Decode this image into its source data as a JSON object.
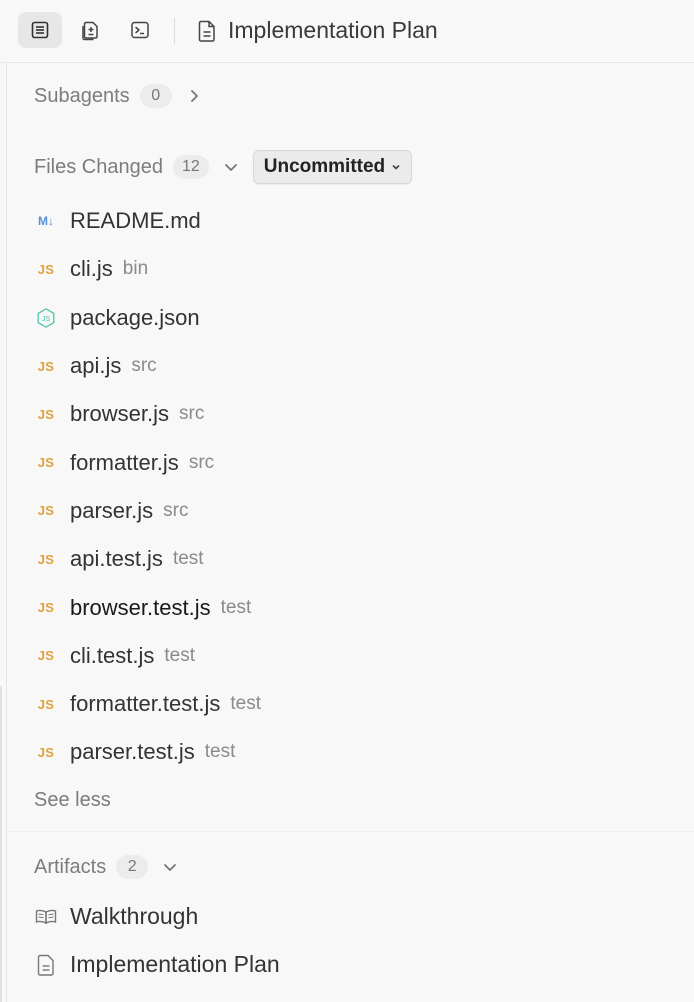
{
  "toolbar": {
    "title": "Implementation Plan",
    "buttons": [
      "document-icon",
      "files-diff-icon",
      "terminal-icon"
    ]
  },
  "subagents": {
    "label": "Subagents",
    "count": "0"
  },
  "files_changed": {
    "label": "Files Changed",
    "count": "12",
    "filter_label": "Uncommitted",
    "files": [
      {
        "name": "README.md",
        "dir": "",
        "icon": "markdown-icon"
      },
      {
        "name": "cli.js",
        "dir": "bin",
        "icon": "js-icon"
      },
      {
        "name": "package.json",
        "dir": "",
        "icon": "nodejs-icon"
      },
      {
        "name": "api.js",
        "dir": "src",
        "icon": "js-icon"
      },
      {
        "name": "browser.js",
        "dir": "src",
        "icon": "js-icon"
      },
      {
        "name": "formatter.js",
        "dir": "src",
        "icon": "js-icon"
      },
      {
        "name": "parser.js",
        "dir": "src",
        "icon": "js-icon"
      },
      {
        "name": "api.test.js",
        "dir": "test",
        "icon": "js-icon"
      },
      {
        "name": "browser.test.js",
        "dir": "test",
        "icon": "js-icon"
      },
      {
        "name": "cli.test.js",
        "dir": "test",
        "icon": "js-icon"
      },
      {
        "name": "formatter.test.js",
        "dir": "test",
        "icon": "js-icon"
      },
      {
        "name": "parser.test.js",
        "dir": "test",
        "icon": "js-icon"
      }
    ],
    "see_less_label": "See less"
  },
  "artifacts": {
    "label": "Artifacts",
    "count": "2",
    "items": [
      {
        "name": "Walkthrough",
        "icon": "book-icon"
      },
      {
        "name": "Implementation Plan",
        "icon": "document-icon"
      }
    ]
  },
  "colors": {
    "js_icon": "#e0a23a",
    "markdown_icon": "#5b8fd6",
    "nodejs_icon": "#4fc3a8",
    "background": "#f8f8f8"
  },
  "js_glyph": "JS",
  "md_glyph": "M↓"
}
